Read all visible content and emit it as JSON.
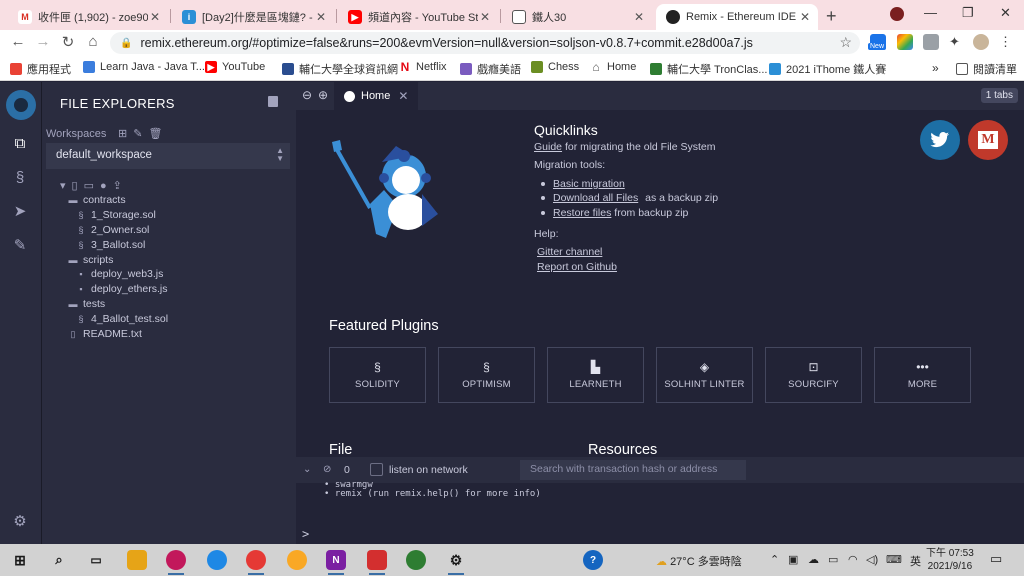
{
  "browser": {
    "tabs": [
      {
        "title": "收件匣 (1,902) - zoe9011",
        "favicon": "gmail-icon",
        "color": "#d93025"
      },
      {
        "title": "[Day2]什麼是區塊鏈? - iT",
        "favicon": "ithome-icon",
        "color": "#2b8fd6"
      },
      {
        "title": "頻道內容 - YouTube Stud",
        "favicon": "youtube-icon",
        "color": "#ff0000"
      },
      {
        "title": "鐵人30",
        "favicon": "document-icon",
        "color": "#555555"
      },
      {
        "title": "Remix - Ethereum IDE",
        "favicon": "remix-icon",
        "color": "#222222"
      }
    ],
    "url": "remix.ethereum.org/#optimize=false&runs=200&evmVersion=null&version=soljson-v0.8.7+commit.e28d00a7.js",
    "extension_badge": "New",
    "bookmarks": [
      {
        "label": "應用程式",
        "color": "#e94235"
      },
      {
        "label": "Learn Java - Java T...",
        "color": "#3b7ddd"
      },
      {
        "label": "YouTube",
        "color": "#ff0000"
      },
      {
        "label": "輔仁大學全球資訊網",
        "color": "#2a4d8f"
      },
      {
        "label": "Netflix",
        "color": "#e50914"
      },
      {
        "label": "戲癮美語",
        "color": "#7a5bbf"
      },
      {
        "label": "Chess",
        "color": "#6b8e23"
      },
      {
        "label": "Home",
        "color": "#555555"
      },
      {
        "label": "輔仁大學 TronClas...",
        "color": "#2e7d32"
      },
      {
        "label": "2021 iThome 鐵人賽",
        "color": "#2b8fd6"
      }
    ],
    "bookmarks_more": "»",
    "reading_list": "閱讀清單"
  },
  "remix": {
    "file_explorer": {
      "title": "FILE EXPLORERS",
      "workspaces_label": "Workspaces",
      "workspace_selected": "default_workspace",
      "tree": [
        {
          "name": "contracts",
          "type": "folder",
          "depth": 1
        },
        {
          "name": "1_Storage.sol",
          "type": "sol",
          "depth": 2
        },
        {
          "name": "2_Owner.sol",
          "type": "sol",
          "depth": 2
        },
        {
          "name": "3_Ballot.sol",
          "type": "sol",
          "depth": 2
        },
        {
          "name": "scripts",
          "type": "folder",
          "depth": 1
        },
        {
          "name": "deploy_web3.js",
          "type": "js",
          "depth": 2
        },
        {
          "name": "deploy_ethers.js",
          "type": "js",
          "depth": 2
        },
        {
          "name": "tests",
          "type": "folder",
          "depth": 1
        },
        {
          "name": "4_Ballot_test.sol",
          "type": "sol",
          "depth": 2
        },
        {
          "name": "README.txt",
          "type": "txt",
          "depth": 1
        }
      ]
    },
    "editor": {
      "home_tab": "Home",
      "tabs_count": "1 tabs"
    },
    "home": {
      "quicklinks_title": "Quicklinks",
      "guide_link": "Guide",
      "guide_text": "for migrating the old File System",
      "migration_label": "Migration tools:",
      "basic_migration": "Basic migration",
      "download_all": "Download all Files",
      "download_suffix": "as a backup zip",
      "restore": "Restore files",
      "restore_suffix": "from backup zip",
      "help_label": "Help:",
      "gitter": "Gitter channel",
      "report": "Report on Github",
      "medium_letter": "M",
      "featured_title": "Featured Plugins",
      "plugins": [
        {
          "label": "SOLIDITY",
          "icon": "solidity-icon"
        },
        {
          "label": "OPTIMISM",
          "icon": "optimism-icon"
        },
        {
          "label": "LEARNETH",
          "icon": "learneth-icon"
        },
        {
          "label": "SOLHINT LINTER",
          "icon": "solhint-icon"
        },
        {
          "label": "SOURCIFY",
          "icon": "sourcify-icon"
        },
        {
          "label": "MORE",
          "icon": "more-icon"
        }
      ],
      "file_title": "File",
      "resources_title": "Resources"
    },
    "terminal": {
      "pending_count": "0",
      "listen_label": "listen on network",
      "search_placeholder": "Search with transaction hash or address",
      "line1": "• swarmgw",
      "line2": "• remix (run remix.help() for more info)",
      "prompt": ">"
    }
  },
  "taskbar": {
    "weather": "27°C 多雲時陰",
    "ime": "英",
    "time": "下午 07:53",
    "date": "2021/9/16"
  }
}
